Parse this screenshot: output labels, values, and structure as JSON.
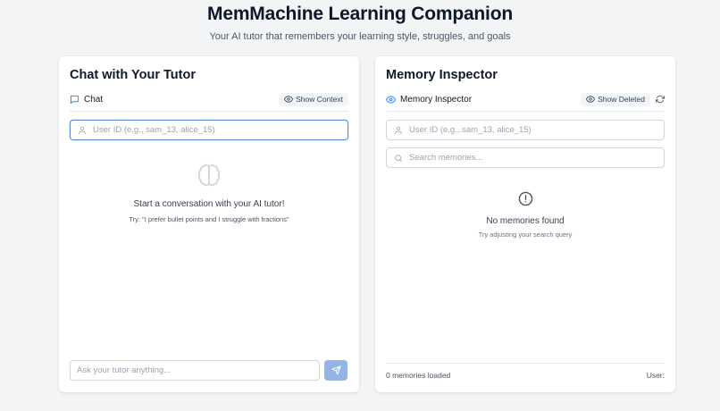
{
  "header": {
    "title": "MemMachine Learning Companion",
    "subtitle": "Your AI tutor that remembers your learning style, struggles, and goals"
  },
  "chat": {
    "card_title": "Chat with Your Tutor",
    "tab_label": "Chat",
    "show_context_label": "Show Context",
    "user_id_placeholder": "User ID (e.g., sam_13, alice_15)",
    "empty_title": "Start a conversation with your AI tutor!",
    "empty_hint": "Try: \"I prefer bullet points and I struggle with fractions\"",
    "message_placeholder": "Ask your tutor anything..."
  },
  "memory": {
    "card_title": "Memory Inspector",
    "tab_label": "Memory Inspector",
    "show_deleted_label": "Show Deleted",
    "user_id_placeholder": "User ID (e.g., sam_13, alice_15)",
    "search_placeholder": "Search memories...",
    "empty_title": "No memories found",
    "empty_hint": "Try adjusting your search query",
    "footer_count": "0 memories loaded",
    "footer_user": "User:"
  },
  "colors": {
    "accent": "#3b82f6",
    "send_button": "#93b4e6",
    "focus_border": "#5b8cc8"
  },
  "icons": {
    "chat_tab": "message-square-icon",
    "show_context": "eye-icon",
    "user": "user-icon",
    "empty_chat": "brain-icon",
    "send": "send-icon",
    "memory_tab": "eye-icon",
    "show_deleted": "eye-icon",
    "refresh": "refresh-icon",
    "search": "search-icon",
    "empty_memory": "alert-circle-icon"
  }
}
